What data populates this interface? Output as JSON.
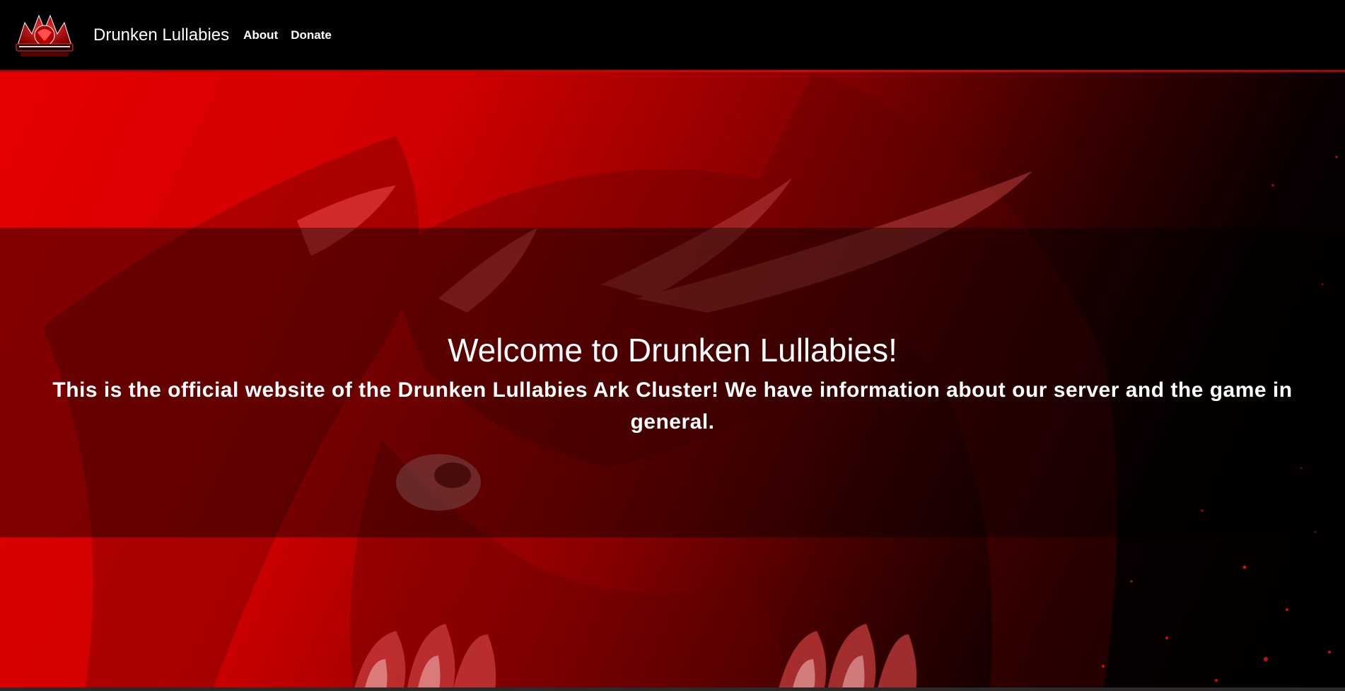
{
  "navbar": {
    "logo_icon": "dragon-logo-icon",
    "brand": "Drunken Lullabies",
    "links": [
      {
        "label": "About"
      },
      {
        "label": "Donate"
      }
    ]
  },
  "hero": {
    "title": "Welcome to Drunken Lullabies!",
    "subtitle": "This is the official website of the Drunken Lullabies Ark Cluster! We have information about our server and the game in general.",
    "background_icon": "dragon-mascot-art"
  },
  "colors": {
    "primary_red": "#e00000",
    "dark": "#000000",
    "text": "#ffffff"
  }
}
